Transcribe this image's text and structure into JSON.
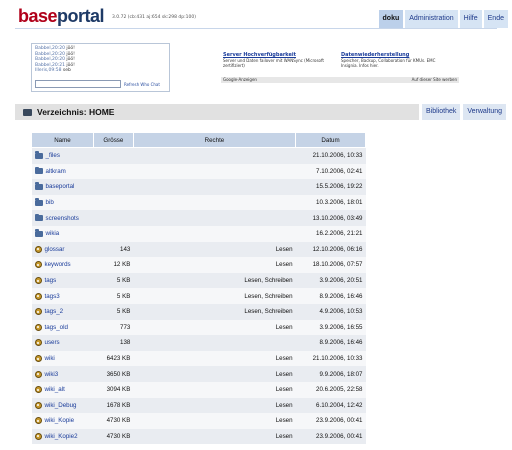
{
  "header": {
    "logo_part1": "base",
    "logo_part2": "portal",
    "version": "3.0.72 (cb:431 aj:654 sk:298 dp:100)",
    "nav": [
      {
        "label": "doku",
        "active": true
      },
      {
        "label": "Administration",
        "active": false
      },
      {
        "label": "Hilfe",
        "active": false
      },
      {
        "label": "Ende",
        "active": false
      }
    ]
  },
  "chat": {
    "lines": [
      {
        "who": "Babbel,20:20",
        "msg": "jöö!"
      },
      {
        "who": "Babbel,20:20",
        "msg": "jöö!"
      },
      {
        "who": "Babbel,20:20",
        "msg": "jöö!"
      },
      {
        "who": "Babbel,20:21",
        "msg": "jöö!"
      },
      {
        "who": "Illeris,09:58",
        "msg": "seb"
      }
    ],
    "input_value": "",
    "refresh_label": "Refresh Who Chat"
  },
  "ads": {
    "ad1": {
      "title": "Server Hochverfügbarkeit",
      "text": "Server und Daten failover mit WANSync (Microsoft zertifiziert)"
    },
    "ad2": {
      "title": "Datenwiederherstellung",
      "text": "Speicher, Backup, Collaboration für KMUs. EMC Insignia. Infos hier."
    },
    "footer_left": "Google-Anzeigen",
    "footer_right": "Auf dieser Site werben"
  },
  "dirbar": {
    "title": "Verzeichnis: HOME",
    "btn_bibliothek": "Bibliothek",
    "btn_verwaltung": "Verwaltung"
  },
  "table": {
    "columns": [
      "Name",
      "Grösse",
      "Rechte",
      "Datum"
    ],
    "rows": [
      {
        "type": "folder",
        "name": "_files",
        "size": "",
        "rights": "",
        "date": "21.10.2006, 10:33"
      },
      {
        "type": "folder",
        "name": "altkram",
        "size": "",
        "rights": "",
        "date": "7.10.2006, 02:41"
      },
      {
        "type": "folder",
        "name": "baseportal",
        "size": "",
        "rights": "",
        "date": "15.5.2006, 19:22"
      },
      {
        "type": "folder",
        "name": "bib",
        "size": "",
        "rights": "",
        "date": "10.3.2006, 18:01"
      },
      {
        "type": "folder",
        "name": "screenshots",
        "size": "",
        "rights": "",
        "date": "13.10.2006, 03:49"
      },
      {
        "type": "folder",
        "name": "wikia",
        "size": "",
        "rights": "",
        "date": "16.2.2006, 21:21"
      },
      {
        "type": "file",
        "name": "glossar",
        "size": "143",
        "rights": "Lesen",
        "date": "12.10.2006, 06:16"
      },
      {
        "type": "file",
        "name": "keywords",
        "size": "12 KB",
        "rights": "Lesen",
        "date": "18.10.2006, 07:57"
      },
      {
        "type": "file",
        "name": "tags",
        "size": "5 KB",
        "rights": "Lesen, Schreiben",
        "date": "3.9.2006, 20:51"
      },
      {
        "type": "file",
        "name": "tags3",
        "size": "5 KB",
        "rights": "Lesen, Schreiben",
        "date": "8.9.2006, 16:46"
      },
      {
        "type": "file",
        "name": "tags_2",
        "size": "5 KB",
        "rights": "Lesen, Schreiben",
        "date": "4.9.2006, 10:53"
      },
      {
        "type": "file",
        "name": "tags_old",
        "size": "773",
        "rights": "Lesen",
        "date": "3.9.2006, 16:55"
      },
      {
        "type": "file",
        "name": "users",
        "size": "138",
        "rights": "",
        "date": "8.9.2006, 16:46"
      },
      {
        "type": "file",
        "name": "wiki",
        "size": "6423 KB",
        "rights": "Lesen",
        "date": "21.10.2006, 10:33"
      },
      {
        "type": "file",
        "name": "wiki3",
        "size": "3650 KB",
        "rights": "Lesen",
        "date": "9.9.2006, 18:07"
      },
      {
        "type": "file",
        "name": "wiki_alt",
        "size": "3094 KB",
        "rights": "Lesen",
        "date": "20.6.2005, 22:58"
      },
      {
        "type": "file",
        "name": "wiki_Debug",
        "size": "1678 KB",
        "rights": "Lesen",
        "date": "6.10.2004, 12:42"
      },
      {
        "type": "file",
        "name": "wiki_Kopie",
        "size": "4730 KB",
        "rights": "Lesen",
        "date": "23.9.2006, 00:41"
      },
      {
        "type": "file",
        "name": "wiki_Kopie2",
        "size": "4730 KB",
        "rights": "Lesen",
        "date": "23.9.2006, 00:41"
      }
    ]
  },
  "colors": {
    "logo_red": "#b0001a",
    "logo_blue": "#1e3a66",
    "header_tab": "#d6e4f4",
    "table_header": "#c5d3e6",
    "link": "#1a3c9a"
  }
}
